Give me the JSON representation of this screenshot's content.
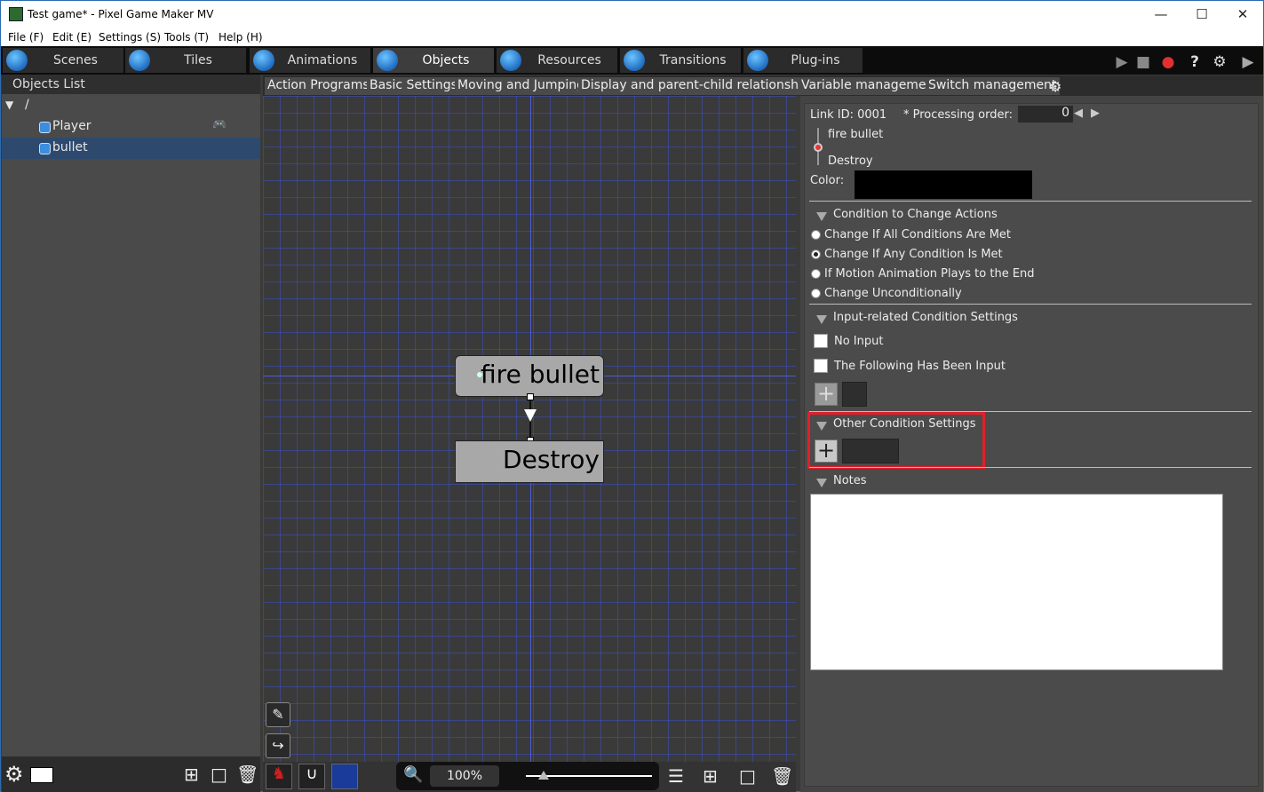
{
  "window": {
    "title": "Test game* - Pixel Game Maker MV",
    "min": "—",
    "max": "☐",
    "close": "✕"
  },
  "menu": [
    "File (F)",
    "Edit (E)",
    "Settings (S)",
    "Tools (T)",
    "Help (H)"
  ],
  "main_tabs": [
    "Scenes",
    "Tiles",
    "Animations",
    "Objects",
    "Resources",
    "Transitions",
    "Plug-ins"
  ],
  "objects_list": {
    "title": "Objects List",
    "root": "/",
    "items": [
      "Player",
      "bullet"
    ]
  },
  "sub_tabs": [
    "Action Programs",
    "Basic Settings",
    "Moving and Jumping",
    "Display and parent-child relationship",
    "Variable management",
    "Switch management"
  ],
  "nodes": {
    "first": "fire bullet",
    "second": "Destroy"
  },
  "zoom": "100%",
  "link": {
    "id_label": "Link ID: 0001",
    "order_label": "* Processing order:",
    "order_value": "0",
    "from": "fire bullet",
    "to": "Destroy",
    "color_label": "Color:"
  },
  "condition": {
    "title": "Condition to Change Actions",
    "options": [
      "Change If All Conditions Are Met",
      "Change If Any Condition Is Met",
      "If Motion Animation Plays to the End",
      "Change Unconditionally"
    ],
    "selected_index": 1
  },
  "input_settings": {
    "title": "Input-related Condition Settings",
    "no_input": "No Input",
    "following": "The Following Has Been Input"
  },
  "other_settings": {
    "title": "Other Condition Settings"
  },
  "notes": {
    "title": "Notes",
    "value": ""
  },
  "colors": {
    "highlight": "#e0202a",
    "selected_row": "#2d4a6e",
    "grid": "#3c50c8"
  }
}
